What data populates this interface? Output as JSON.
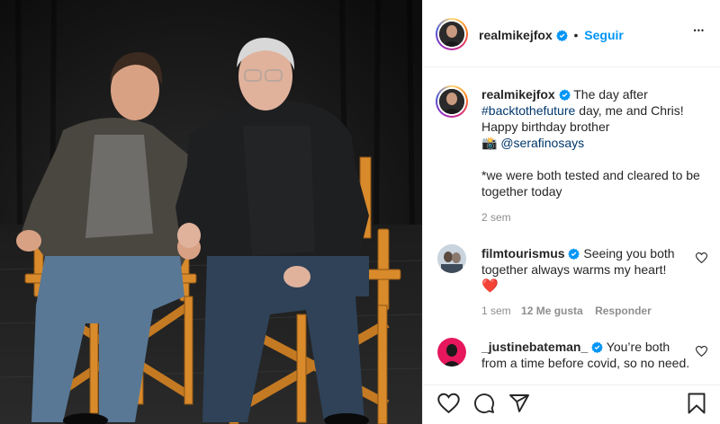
{
  "post": {
    "author": "realmikejfox",
    "follow_separator": "•",
    "follow_label": "Seguir",
    "more_label": "•••"
  },
  "caption": {
    "username": "realmikejfox",
    "text_1": "The day after",
    "hashtag": "#backtothefuture",
    "text_2": "day, me and Chris! Happy birthday brother",
    "camera": "📸",
    "mention": "@serafinosays",
    "text_3": "*we were both tested and cleared to be together today",
    "time": "2 sem"
  },
  "comments": [
    {
      "username": "filmtourismus",
      "text": "Seeing you both together always warms my heart!",
      "emoji": "❤️",
      "time": "1 sem",
      "likes": "12 Me gusta",
      "reply": "Responder"
    },
    {
      "username": "_justinebateman_",
      "text": "You’re both from a time before covid, so no need."
    }
  ],
  "icons": {
    "like": "heart-icon",
    "comment": "comment-icon",
    "share": "paper-plane-icon",
    "save": "bookmark-icon",
    "verified": "verified-badge-icon",
    "more": "more-options-icon"
  },
  "colors": {
    "follow": "#0095f6",
    "verified": "#0095f6",
    "link": "#00376b",
    "muted": "#8e8e8e",
    "chair_wood": "#d98a2b"
  }
}
